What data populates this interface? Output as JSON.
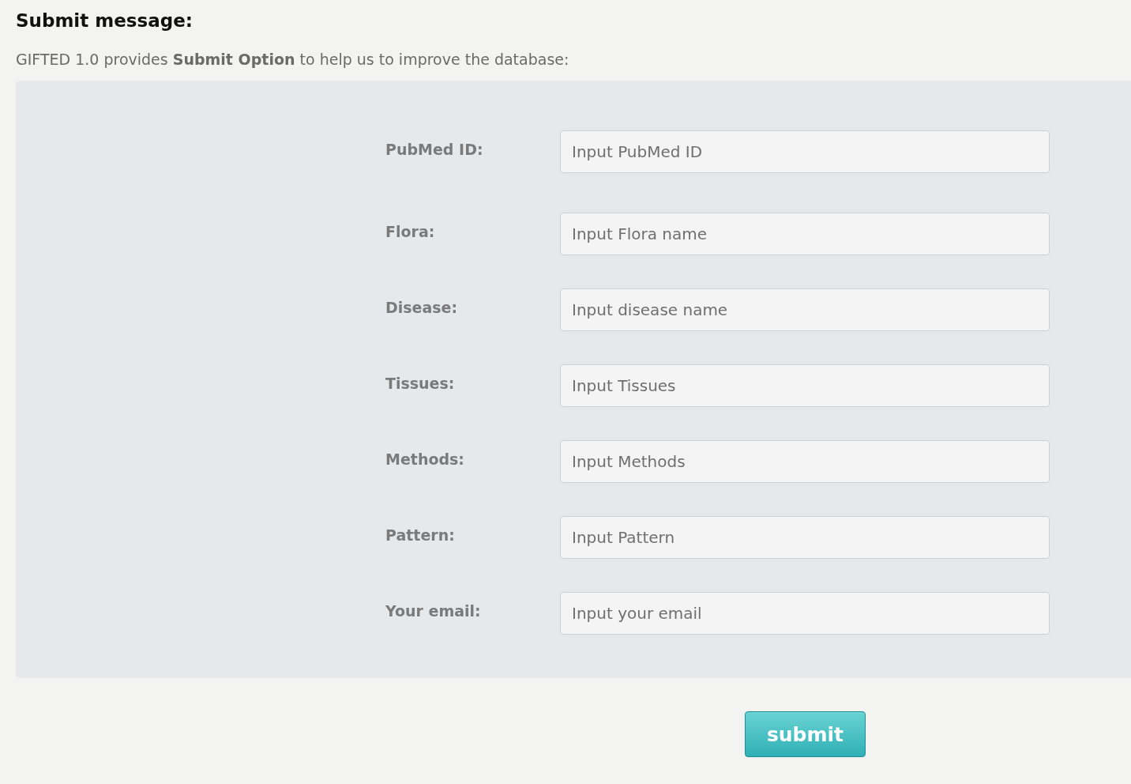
{
  "title": "Submit message:",
  "intro": "GIFTED 1.0 provides **Submit Option** to help us to improve the database:",
  "fields": [
    {
      "label": "PubMed ID:",
      "placeholder": "Input PubMed ID"
    },
    {
      "label": "Flora:",
      "placeholder": "Input Flora name"
    },
    {
      "label": "Disease:",
      "placeholder": "Input disease name"
    },
    {
      "label": "Tissues:",
      "placeholder": "Input Tissues"
    },
    {
      "label": "Methods:",
      "placeholder": "Input Methods"
    },
    {
      "label": "Pattern:",
      "placeholder": "Input Pattern"
    },
    {
      "label": "Your email:",
      "placeholder": "Input your email"
    }
  ],
  "submit_button": "submit"
}
